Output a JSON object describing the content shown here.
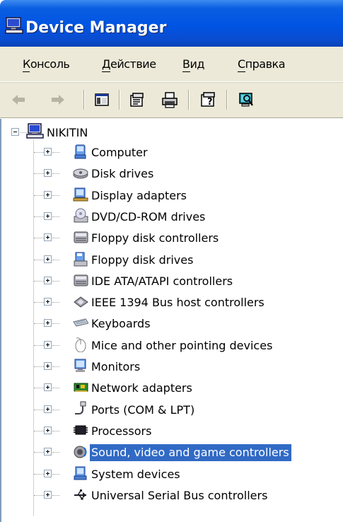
{
  "window": {
    "title": "Device Manager",
    "icon": "computer-monitor-icon"
  },
  "menu": {
    "items": [
      {
        "label": "Консоль"
      },
      {
        "label": "Действие"
      },
      {
        "label": "Вид"
      },
      {
        "label": "Справка"
      }
    ]
  },
  "toolbar": {
    "buttons": [
      {
        "icon": "back-arrow-icon",
        "enabled": false
      },
      {
        "icon": "forward-arrow-icon",
        "enabled": false
      },
      {
        "icon": "show-hide-console-tree-icon"
      },
      {
        "icon": "properties-icon"
      },
      {
        "icon": "print-icon"
      },
      {
        "icon": "help-icon"
      },
      {
        "icon": "scan-hardware-icon"
      }
    ]
  },
  "tree": {
    "root": {
      "label": "NIKITIN",
      "icon": "computer-icon",
      "expanded": true
    },
    "categories": [
      {
        "label": "Computer",
        "icon": "computer-icon"
      },
      {
        "label": "Disk drives",
        "icon": "disk-drive-icon"
      },
      {
        "label": "Display adapters",
        "icon": "display-adapter-icon"
      },
      {
        "label": "DVD/CD-ROM drives",
        "icon": "cdrom-icon"
      },
      {
        "label": "Floppy disk controllers",
        "icon": "controller-icon"
      },
      {
        "label": "Floppy disk drives",
        "icon": "floppy-icon"
      },
      {
        "label": "IDE ATA/ATAPI controllers",
        "icon": "controller-icon"
      },
      {
        "label": "IEEE 1394 Bus host controllers",
        "icon": "firewire-icon"
      },
      {
        "label": "Keyboards",
        "icon": "keyboard-icon"
      },
      {
        "label": "Mice and other pointing devices",
        "icon": "mouse-icon"
      },
      {
        "label": "Monitors",
        "icon": "monitor-icon"
      },
      {
        "label": "Network adapters",
        "icon": "network-card-icon"
      },
      {
        "label": "Ports (COM & LPT)",
        "icon": "port-icon"
      },
      {
        "label": "Processors",
        "icon": "processor-icon"
      },
      {
        "label": "Sound, video and game controllers",
        "icon": "sound-icon",
        "selected": true
      },
      {
        "label": "System devices",
        "icon": "system-device-icon"
      },
      {
        "label": "Universal Serial Bus controllers",
        "icon": "usb-icon"
      }
    ]
  },
  "colors": {
    "title_bar": "#0054e3",
    "menu_bg": "#ece9d8",
    "selection": "#316ac5"
  }
}
